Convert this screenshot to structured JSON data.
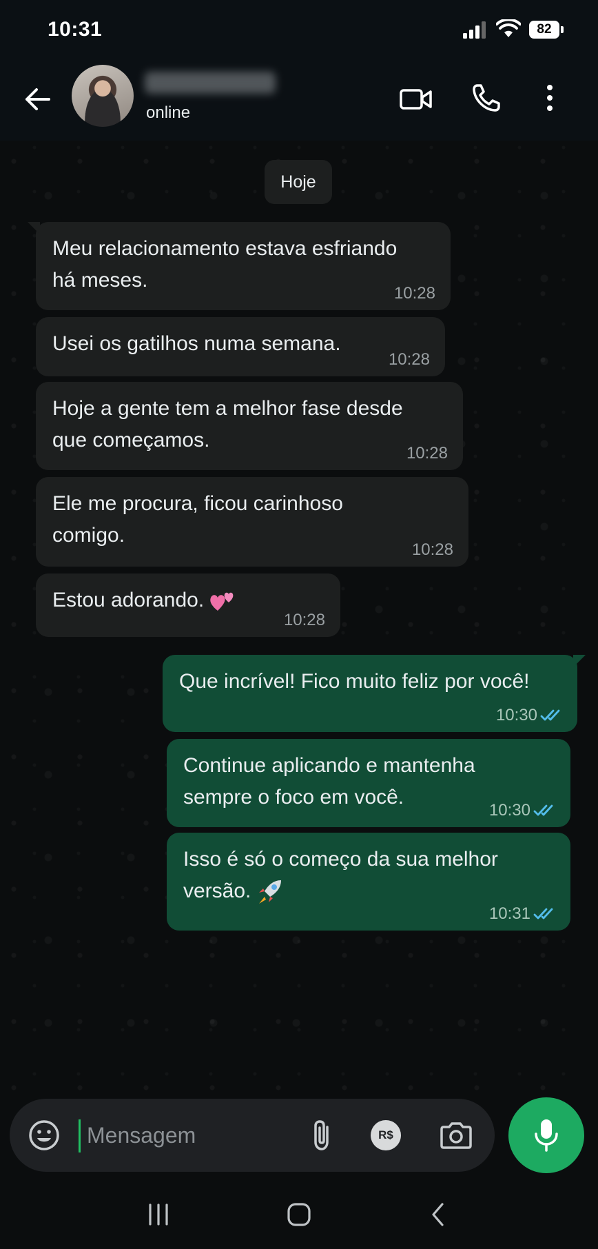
{
  "status_bar": {
    "time": "10:31",
    "battery": "82"
  },
  "header": {
    "contact_name": "",
    "contact_status": "online",
    "back_icon": "arrow-left-icon",
    "video_icon": "video-camera-icon",
    "call_icon": "phone-icon",
    "menu_icon": "more-vertical-icon"
  },
  "chat": {
    "date_chip": "Hoje",
    "incoming": [
      {
        "text": "Meu relacionamento estava esfriando\nhá meses.",
        "time": "10:28"
      },
      {
        "text": "Usei os gatilhos numa semana.",
        "time": "10:28"
      },
      {
        "text": "Hoje a gente tem a melhor fase desde\nque começamos.",
        "time": "10:28"
      },
      {
        "text": "Ele me procura, ficou carinhoso\ncomigo.",
        "time": "10:28"
      },
      {
        "text": "Estou adorando.",
        "time": "10:28",
        "emoji": "two-hearts"
      }
    ],
    "outgoing": [
      {
        "text": "Que incrível! Fico muito feliz por você!",
        "time": "10:30",
        "status": "read"
      },
      {
        "text": "Continue aplicando e mantenha\nsempre o foco em você.",
        "time": "10:30",
        "status": "read"
      },
      {
        "text": "Isso é só o começo da sua melhor\nversão.",
        "time": "10:31",
        "status": "read",
        "emoji": "rocket"
      }
    ]
  },
  "composer": {
    "placeholder": "Mensagem",
    "pay_label": "R$",
    "icons": [
      "emoji-icon",
      "paperclip-icon",
      "payment-icon",
      "camera-icon",
      "microphone-icon"
    ]
  },
  "colors": {
    "background": "#0b0d0e",
    "incoming_bubble": "#1d1f1f",
    "outgoing_bubble": "#114d36",
    "read_ticks": "#53bdeb",
    "accent_green": "#1daa61"
  },
  "navbar": {
    "icons": [
      "recent-apps-icon",
      "home-icon",
      "back-icon"
    ]
  }
}
